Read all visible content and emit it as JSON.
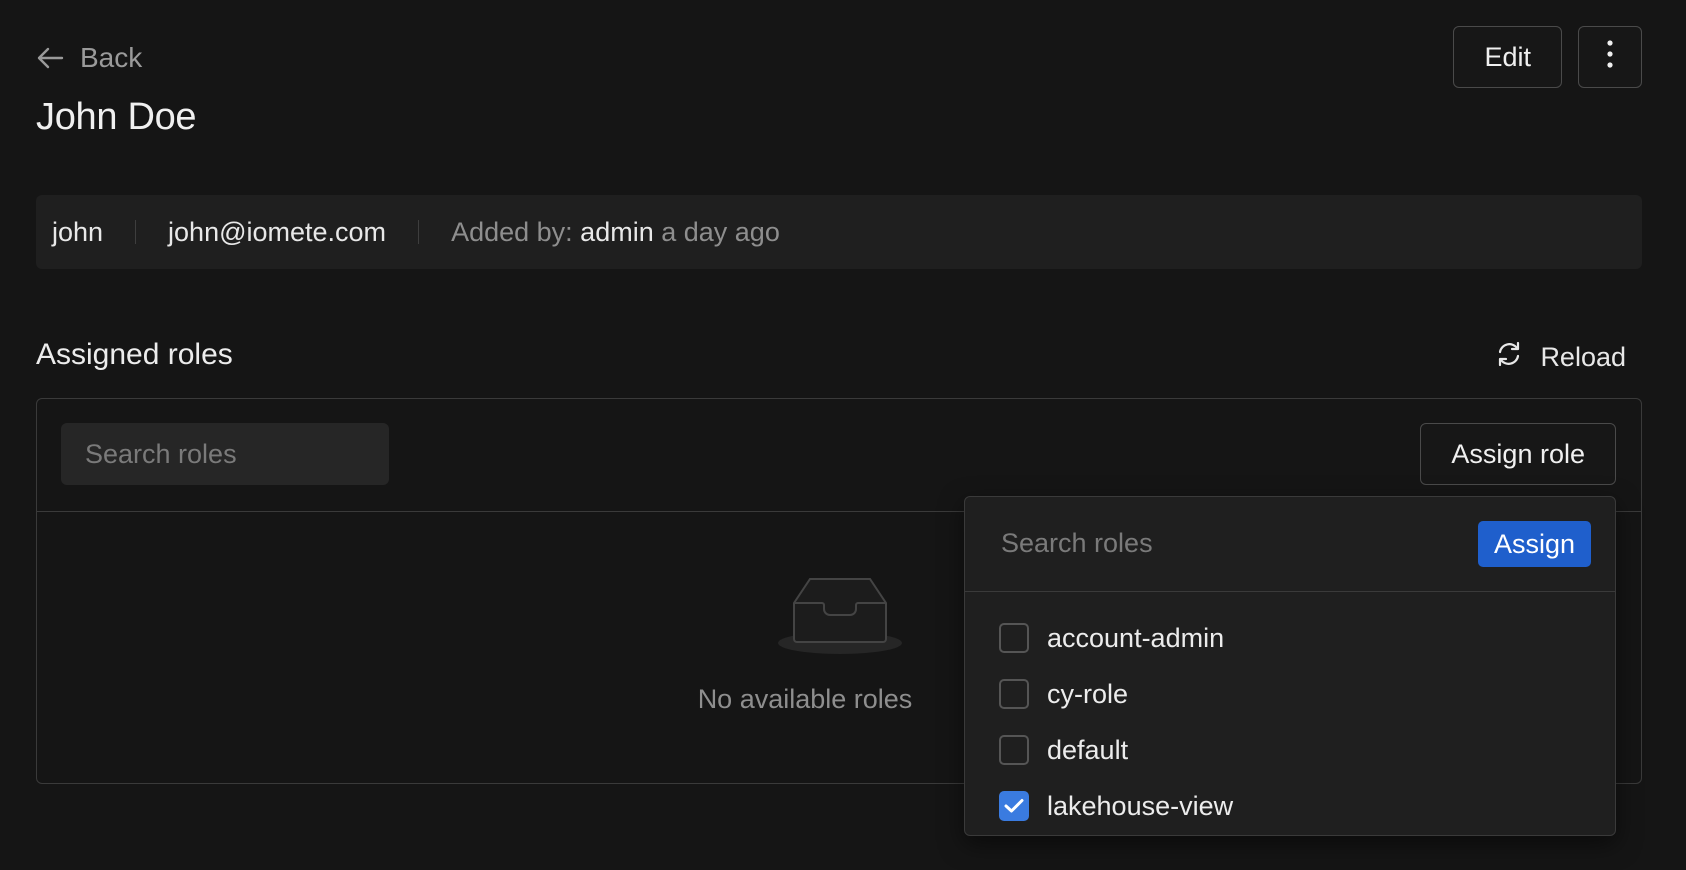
{
  "header": {
    "back_label": "Back",
    "title": "John Doe",
    "edit_label": "Edit",
    "more_label": "⋮"
  },
  "user_info": {
    "username": "john",
    "email": "john@iomete.com",
    "added_by_prefix": "Added by:",
    "added_by_user": "admin",
    "added_time": "a day ago"
  },
  "roles_section": {
    "title": "Assigned roles",
    "reload_label": "Reload",
    "search_placeholder": "Search roles",
    "assign_role_label": "Assign role",
    "empty_text": "No available roles"
  },
  "assign_dropdown": {
    "search_placeholder": "Search roles",
    "assign_label": "Assign",
    "roles": [
      {
        "label": "account-admin",
        "checked": false
      },
      {
        "label": "cy-role",
        "checked": false
      },
      {
        "label": "default",
        "checked": false
      },
      {
        "label": "lakehouse-view",
        "checked": true
      }
    ]
  },
  "colors": {
    "background": "#151515",
    "primary": "#1f5fcc",
    "checkbox_checked": "#3a7be0"
  }
}
